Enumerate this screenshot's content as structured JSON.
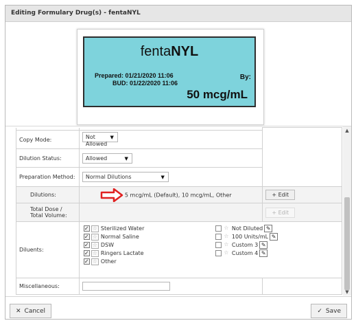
{
  "dialog": {
    "title": "Editing Formulary Drug(s) - fentaNYL"
  },
  "label": {
    "drug_name_lower": "fenta",
    "drug_name_upper": "NYL",
    "prepared": "Prepared: 01/21/2020 11:06",
    "bud": "BUD: 01/22/2020 11:06",
    "by": "By:",
    "concentration": "50 mcg/mL",
    "background_color": "#7ed3dc"
  },
  "form": {
    "copy_mode": {
      "label": "Copy Mode:",
      "value": "Not Allowed"
    },
    "dilution_status": {
      "label": "Dilution Status:",
      "value": "Allowed"
    },
    "preparation_method": {
      "label": "Preparation Method:",
      "value": "Normal Dilutions"
    },
    "dilutions": {
      "label": "Dilutions:",
      "value": "5 mcg/mL (Default), 10 mcg/mL, Other",
      "edit_label": "Edit"
    },
    "total_dose": {
      "label": "Total Dose / Total Volume:",
      "edit_label": "Edit"
    },
    "diluents": {
      "label": "Diluents:",
      "left": [
        {
          "name": "Sterilized Water",
          "checked": true
        },
        {
          "name": "Normal Saline",
          "checked": true
        },
        {
          "name": "DSW",
          "checked": true
        },
        {
          "name": "Ringers Lactate",
          "checked": true
        },
        {
          "name": "Other",
          "checked": true
        }
      ],
      "right": [
        {
          "name": "Not Diluted",
          "checked": false
        },
        {
          "name": "100 Units/mL",
          "checked": false
        },
        {
          "name": "Custom 3",
          "checked": false
        },
        {
          "name": "Custom 4",
          "checked": false
        }
      ]
    },
    "miscellaneous": {
      "label": "Miscellaneous:",
      "value": ""
    }
  },
  "footer": {
    "cancel_label": "Cancel",
    "save_label": "Save"
  },
  "colors": {
    "arrow": "#e02020"
  }
}
